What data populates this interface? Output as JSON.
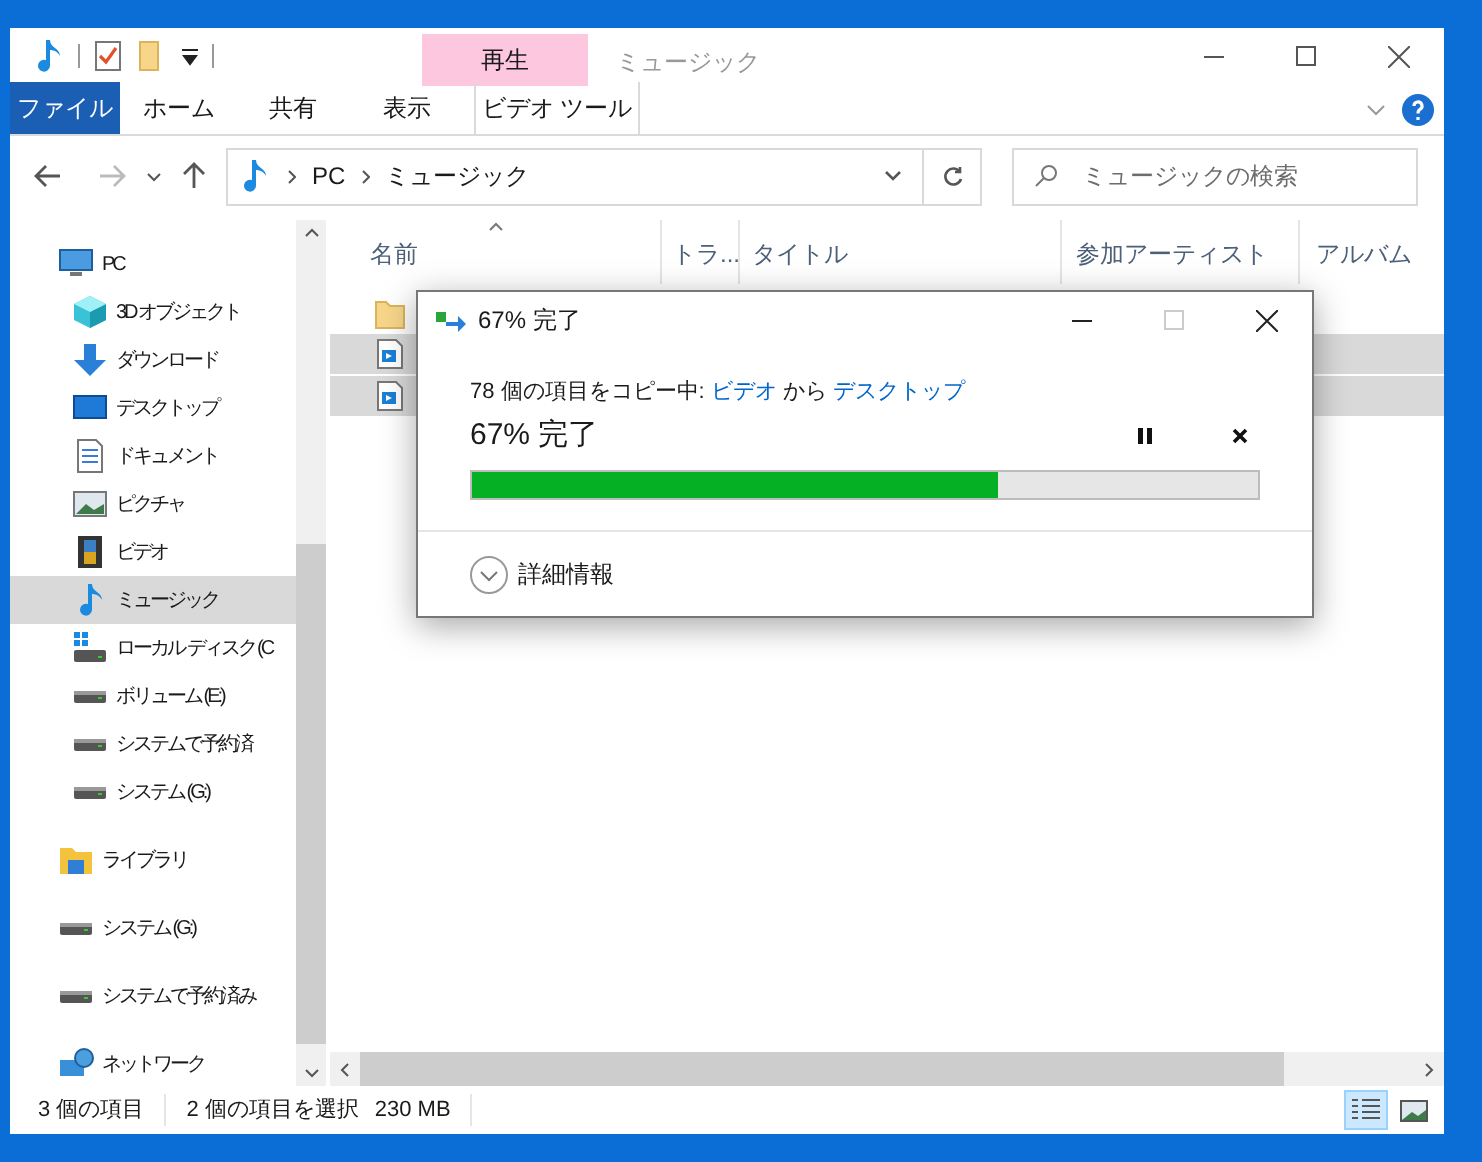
{
  "window": {
    "title": "ミュージック"
  },
  "ribbon": {
    "context_group": "再生",
    "tabs": [
      {
        "label": "ファイル",
        "kind": "file"
      },
      {
        "label": "ホーム",
        "kind": "plain"
      },
      {
        "label": "共有",
        "kind": "plain"
      },
      {
        "label": "表示",
        "kind": "plain"
      },
      {
        "label": "ビデオ ツール",
        "kind": "contextual"
      }
    ]
  },
  "address": {
    "path": [
      "PC",
      "ミュージック"
    ],
    "search": {
      "placeholder": "ミュージックの検索"
    }
  },
  "navigation": [
    {
      "label": "PC",
      "kind": "pc",
      "selected": false,
      "children": [
        {
          "label": "3D オブジェクト",
          "kind": "cube",
          "selected": false
        },
        {
          "label": "ダウンロード",
          "kind": "download",
          "selected": false
        },
        {
          "label": "デスクトップ",
          "kind": "desktop",
          "selected": false
        },
        {
          "label": "ドキュメント",
          "kind": "document",
          "selected": false
        },
        {
          "label": "ピクチャ",
          "kind": "picture",
          "selected": false
        },
        {
          "label": "ビデオ",
          "kind": "video",
          "selected": false
        },
        {
          "label": "ミュージック",
          "kind": "music",
          "selected": true
        },
        {
          "label": "ローカル ディスク (C",
          "kind": "system-drive",
          "selected": false
        },
        {
          "label": "ボリューム (E:)",
          "kind": "drive",
          "selected": false
        },
        {
          "label": "システムで予約済",
          "kind": "drive",
          "selected": false
        },
        {
          "label": "システム (G:)",
          "kind": "drive",
          "selected": false
        }
      ]
    },
    {
      "label": "ライブラリ",
      "kind": "library",
      "selected": false
    },
    {
      "label": "システム (G:)",
      "kind": "drive",
      "selected": false
    },
    {
      "label": "システムで予約済み",
      "kind": "drive",
      "selected": false
    },
    {
      "label": "ネットワーク",
      "kind": "network",
      "selected": false
    }
  ],
  "table": {
    "columns": [
      {
        "label": "名前",
        "sorted": true
      },
      {
        "label": "トラ...",
        "sorted": false
      },
      {
        "label": "タイトル",
        "sorted": false
      },
      {
        "label": "参加アーティスト",
        "sorted": false
      },
      {
        "label": "アルバム",
        "sorted": false
      }
    ],
    "rows": [
      {
        "kind": "folder",
        "selected": false
      },
      {
        "kind": "video",
        "selected": true
      },
      {
        "kind": "video",
        "selected": true
      }
    ]
  },
  "copy_dialog": {
    "title": "67% 完了",
    "message": {
      "prefix": "78 個の項目をコピー中: ",
      "source": "ビデオ",
      "middle": " から ",
      "destination": "デスクトップ"
    },
    "heading": "67% 完了",
    "progress": {
      "level": 0.67
    },
    "details": "詳細情報"
  },
  "status_bar": {
    "item_count": "3 個の項目",
    "selection": "2 個の項目を選択",
    "size": "230 MB",
    "views": [
      {
        "kind": "details",
        "selected": true
      },
      {
        "kind": "tiles",
        "selected": false
      }
    ]
  }
}
